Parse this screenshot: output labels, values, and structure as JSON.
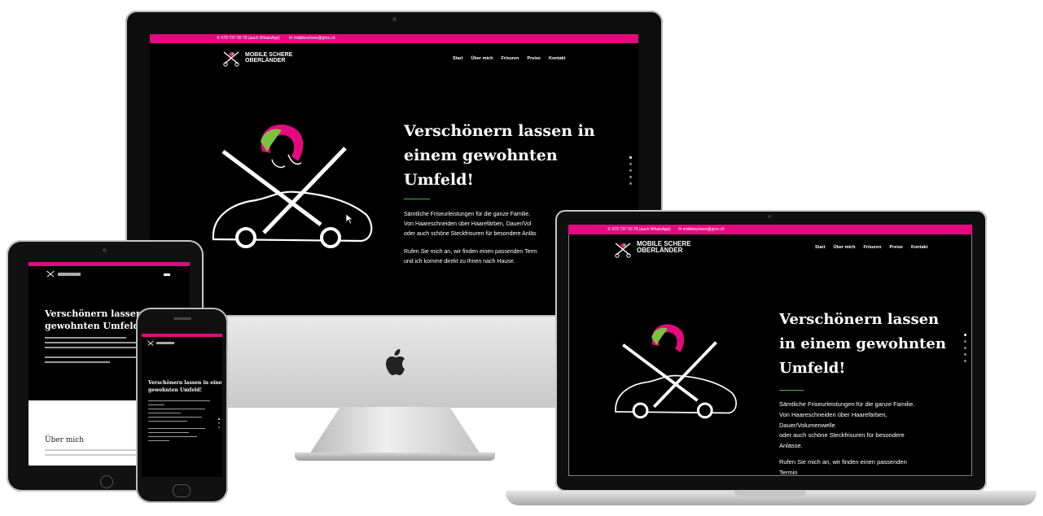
{
  "site": {
    "phone": "079 737 00 79 (auch WhatsApp)",
    "email": "mobileschere@gmx.ch",
    "logo_line1": "MOBILE SCHERE",
    "logo_line2": "OBERLÄNDER",
    "nav": [
      "Start",
      "Über mich",
      "Frisuren",
      "Preise",
      "Kontakt"
    ],
    "hero_title": "Verschönern lassen in einem gewohnten Umfeld!",
    "hero_title_lines": [
      "Verschönern lassen in",
      "einem gewohnten",
      "Umfeld!"
    ],
    "hero_title_lines_mac": [
      "Verschönern lassen",
      "in einem gewohnten",
      "Umfeld!"
    ],
    "para1_lines": [
      "Sämtliche Friseurleistungen für die ganze Familie.",
      "Von Haareschneiden über Haarefärben, Dauer/Vol",
      "oder auch schöne Steckfrisuren für besondere Anläs"
    ],
    "para2_lines": [
      "Rufen Sie mich an, wir finden einen passenden Term",
      "und ich komme direkt zu Ihnen nach Hause."
    ],
    "mac_para1_lines": [
      "Sämtliche Friseurleistungen für die ganze Familie.",
      "Von Haareschneiden über Haarefärben,",
      "Dauer/Volumenwelle",
      "oder auch schöne Steckfrisuren für besondere",
      "Anlässe."
    ],
    "mac_para2_lines": [
      "Rufen Sie mich an, wir finden einen passenden",
      "Termin"
    ],
    "tablet_title_lines": [
      "Verschönern lassen in ein",
      "gewohnten Umfeld!"
    ],
    "tablet_section": "Über mich",
    "phone_title_lines": [
      "Verschönern lassen in einem",
      "gewohnten Umfeld!"
    ]
  },
  "colors": {
    "brand_pink": "#e5097f",
    "accent_green": "#3fb34f",
    "background": "#000000"
  },
  "icons": [
    "phone-icon",
    "mail-icon",
    "scissors-logo-icon",
    "apple-logo-icon",
    "mouse-cursor-icon"
  ]
}
